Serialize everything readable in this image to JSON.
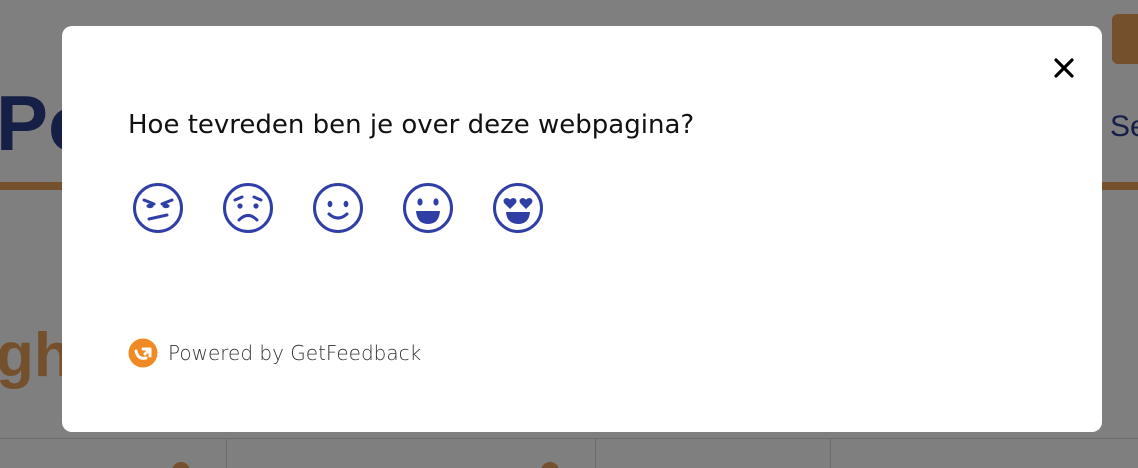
{
  "survey": {
    "question": "Hoe tevreden ben je over deze webpagina?",
    "options": [
      {
        "icon": "angry-face-icon"
      },
      {
        "icon": "sad-face-icon"
      },
      {
        "icon": "smiling-face-icon"
      },
      {
        "icon": "grinning-face-icon"
      },
      {
        "icon": "heart-eyes-face-icon"
      }
    ],
    "close_icon": "close-icon",
    "footer": {
      "text": "Powered by GetFeedback",
      "logo_icon": "getfeedback-logo-icon"
    }
  },
  "background": {
    "title_fragment": "Po",
    "nav_fragment": "Se",
    "heading_fragment": "gh"
  },
  "colors": {
    "icon_blue": "#2f3fa6",
    "brand_orange": "#e8a05a",
    "logo_orange": "#f08a24",
    "overlay": "rgba(0,0,0,0.5)",
    "modal_bg": "#ffffff"
  }
}
